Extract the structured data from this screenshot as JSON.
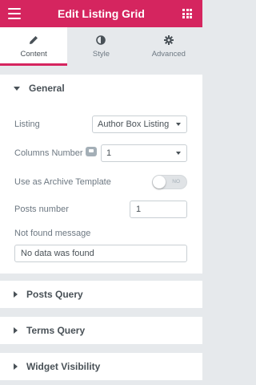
{
  "header": {
    "title": "Edit Listing Grid"
  },
  "tabs": [
    {
      "label": "Content",
      "icon": "pencil-icon",
      "active": true
    },
    {
      "label": "Style",
      "icon": "contrast-icon",
      "active": false
    },
    {
      "label": "Advanced",
      "icon": "gear-icon",
      "active": false
    }
  ],
  "general": {
    "title": "General",
    "listing_label": "Listing",
    "listing_value": "Author Box Listing",
    "columns_label": "Columns Number",
    "columns_value": "1",
    "archive_label": "Use as Archive Template",
    "archive_toggle": "NO",
    "posts_label": "Posts number",
    "posts_value": "1",
    "notfound_label": "Not found message",
    "notfound_value": "No data was found"
  },
  "sections": [
    {
      "title": "Posts Query"
    },
    {
      "title": "Terms Query"
    },
    {
      "title": "Widget Visibility"
    }
  ],
  "colors": {
    "accent": "#d5255f",
    "panel": "#ffffff",
    "background": "#e6e9ec"
  }
}
